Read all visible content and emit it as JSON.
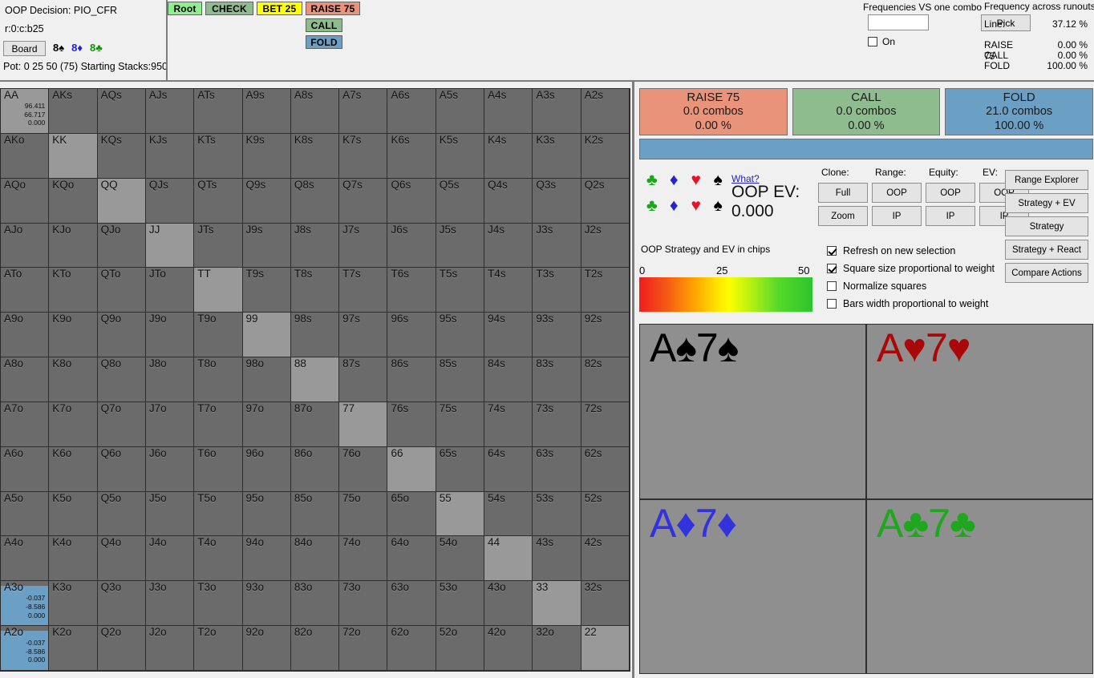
{
  "header": {
    "decision_label": "OOP Decision:  PIO_CFR",
    "line_path": "r:0:c:b25",
    "board_button": "Board",
    "board_cards": [
      {
        "rank": "8",
        "suit": "♠",
        "suit_name": "spade"
      },
      {
        "rank": "8",
        "suit": "♦",
        "suit_name": "diamond"
      },
      {
        "rank": "8",
        "suit": "♣",
        "suit_name": "club"
      }
    ],
    "pot_line": "Pot: 0 25 50 (75) Starting Stacks:950"
  },
  "tree": {
    "nodes": [
      {
        "label": "Root",
        "key": "root",
        "color": "#90ee90"
      },
      {
        "label": "CHECK",
        "key": "check",
        "color": "#8fbc8f"
      },
      {
        "label": "BET 25",
        "key": "bet25",
        "color": "#ffff00"
      },
      {
        "label": "RAISE 75",
        "key": "raise",
        "color": "#e8937a"
      },
      {
        "label": "CALL",
        "key": "call",
        "color": "#8fbc8f"
      },
      {
        "label": "FOLD",
        "key": "fold",
        "color": "#6b9fc4"
      }
    ]
  },
  "frequencies": {
    "vs_one_combo_label": "Frequencies VS one combo",
    "input_value": "",
    "pick_button": "Pick",
    "on_label": "On",
    "on_checked": false,
    "runouts_title": "Frequency across runouts:",
    "line_label": "Line:",
    "line_value": "37.12 %",
    "rows": [
      {
        "name": "RAISE 75",
        "value": "0.00 %"
      },
      {
        "name": "CALL",
        "value": "0.00 %"
      },
      {
        "name": "FOLD",
        "value": "100.00 %"
      }
    ]
  },
  "actions": [
    {
      "name": "RAISE 75",
      "combos": "0.0 combos",
      "pct": "0.00 %",
      "color": "#e8937a",
      "width_pct": 0
    },
    {
      "name": "CALL",
      "combos": "0.0 combos",
      "pct": "0.00 %",
      "color": "#8fbc8f",
      "width_pct": 0
    },
    {
      "name": "FOLD",
      "combos": "21.0 combos",
      "pct": "100.00 %",
      "color": "#6b9fc4",
      "width_pct": 100
    }
  ],
  "suits": {
    "rows": [
      [
        "club",
        "diamond",
        "heart",
        "spade"
      ],
      [
        "club",
        "diamond",
        "heart",
        "spade"
      ]
    ],
    "glyphs": {
      "club": "♣",
      "diamond": "♦",
      "heart": "♥",
      "spade": "♠"
    }
  },
  "ev": {
    "what_link": "What?",
    "label": "OOP EV:",
    "value": "0.000"
  },
  "scale": {
    "caption": "OOP Strategy and EV in chips",
    "ticks": [
      "0",
      "25",
      "50"
    ]
  },
  "options": [
    {
      "label": "Refresh on new selection",
      "checked": true
    },
    {
      "label": "Square size proportional to weight",
      "checked": true
    },
    {
      "label": "Normalize squares",
      "checked": false
    },
    {
      "label": "Bars width proportional to weight",
      "checked": false
    }
  ],
  "mini_columns": [
    {
      "header": "Clone:",
      "buttons": [
        "Full",
        "Zoom"
      ]
    },
    {
      "header": "Range:",
      "buttons": [
        "OOP",
        "IP"
      ]
    },
    {
      "header": "Equity:",
      "buttons": [
        "OOP",
        "IP"
      ]
    },
    {
      "header": "EV:",
      "buttons": [
        "OOP",
        "IP"
      ]
    }
  ],
  "side_buttons": [
    "Range Explorer",
    "Strategy + EV",
    "Strategy",
    "Strategy + React",
    "Compare Actions"
  ],
  "quadrants": [
    {
      "text": "A♠7♠",
      "suit": "spade"
    },
    {
      "text": "A♥7♥",
      "suit": "heart"
    },
    {
      "text": "A♦7♦",
      "suit": "diam"
    },
    {
      "text": "A♣7♣",
      "suit": "club"
    }
  ],
  "matrix": {
    "selected_fill_color": "#6b9fc4",
    "rows": [
      [
        {
          "l": "AA",
          "pair": true,
          "nums": [
            "96.411",
            "66.717",
            "0.000"
          ]
        },
        {
          "l": "AKs"
        },
        {
          "l": "AQs"
        },
        {
          "l": "AJs"
        },
        {
          "l": "ATs"
        },
        {
          "l": "A9s"
        },
        {
          "l": "A8s"
        },
        {
          "l": "A7s"
        },
        {
          "l": "A6s"
        },
        {
          "l": "A5s"
        },
        {
          "l": "A4s"
        },
        {
          "l": "A3s"
        },
        {
          "l": "A2s"
        }
      ],
      [
        {
          "l": "AKo"
        },
        {
          "l": "KK",
          "pair": true
        },
        {
          "l": "KQs"
        },
        {
          "l": "KJs"
        },
        {
          "l": "KTs"
        },
        {
          "l": "K9s"
        },
        {
          "l": "K8s"
        },
        {
          "l": "K7s"
        },
        {
          "l": "K6s"
        },
        {
          "l": "K5s"
        },
        {
          "l": "K4s"
        },
        {
          "l": "K3s"
        },
        {
          "l": "K2s"
        }
      ],
      [
        {
          "l": "AQo"
        },
        {
          "l": "KQo"
        },
        {
          "l": "QQ",
          "pair": true
        },
        {
          "l": "QJs"
        },
        {
          "l": "QTs"
        },
        {
          "l": "Q9s"
        },
        {
          "l": "Q8s"
        },
        {
          "l": "Q7s"
        },
        {
          "l": "Q6s"
        },
        {
          "l": "Q5s"
        },
        {
          "l": "Q4s"
        },
        {
          "l": "Q3s"
        },
        {
          "l": "Q2s"
        }
      ],
      [
        {
          "l": "AJo"
        },
        {
          "l": "KJo"
        },
        {
          "l": "QJo"
        },
        {
          "l": "JJ",
          "pair": true
        },
        {
          "l": "JTs"
        },
        {
          "l": "J9s"
        },
        {
          "l": "J8s"
        },
        {
          "l": "J7s"
        },
        {
          "l": "J6s"
        },
        {
          "l": "J5s"
        },
        {
          "l": "J4s"
        },
        {
          "l": "J3s"
        },
        {
          "l": "J2s"
        }
      ],
      [
        {
          "l": "ATo"
        },
        {
          "l": "KTo"
        },
        {
          "l": "QTo"
        },
        {
          "l": "JTo"
        },
        {
          "l": "TT",
          "pair": true
        },
        {
          "l": "T9s"
        },
        {
          "l": "T8s"
        },
        {
          "l": "T7s"
        },
        {
          "l": "T6s"
        },
        {
          "l": "T5s"
        },
        {
          "l": "T4s"
        },
        {
          "l": "T3s"
        },
        {
          "l": "T2s"
        }
      ],
      [
        {
          "l": "A9o"
        },
        {
          "l": "K9o"
        },
        {
          "l": "Q9o"
        },
        {
          "l": "J9o"
        },
        {
          "l": "T9o"
        },
        {
          "l": "99",
          "pair": true
        },
        {
          "l": "98s"
        },
        {
          "l": "97s"
        },
        {
          "l": "96s"
        },
        {
          "l": "95s"
        },
        {
          "l": "94s"
        },
        {
          "l": "93s"
        },
        {
          "l": "92s"
        }
      ],
      [
        {
          "l": "A8o"
        },
        {
          "l": "K8o"
        },
        {
          "l": "Q8o"
        },
        {
          "l": "J8o"
        },
        {
          "l": "T8o"
        },
        {
          "l": "98o"
        },
        {
          "l": "88",
          "pair": true
        },
        {
          "l": "87s"
        },
        {
          "l": "86s"
        },
        {
          "l": "85s"
        },
        {
          "l": "84s"
        },
        {
          "l": "83s"
        },
        {
          "l": "82s"
        }
      ],
      [
        {
          "l": "A7o"
        },
        {
          "l": "K7o"
        },
        {
          "l": "Q7o"
        },
        {
          "l": "J7o"
        },
        {
          "l": "T7o"
        },
        {
          "l": "97o"
        },
        {
          "l": "87o"
        },
        {
          "l": "77",
          "pair": true
        },
        {
          "l": "76s"
        },
        {
          "l": "75s"
        },
        {
          "l": "74s"
        },
        {
          "l": "73s"
        },
        {
          "l": "72s"
        }
      ],
      [
        {
          "l": "A6o"
        },
        {
          "l": "K6o"
        },
        {
          "l": "Q6o"
        },
        {
          "l": "J6o"
        },
        {
          "l": "T6o"
        },
        {
          "l": "96o"
        },
        {
          "l": "86o"
        },
        {
          "l": "76o"
        },
        {
          "l": "66",
          "pair": true
        },
        {
          "l": "65s"
        },
        {
          "l": "64s"
        },
        {
          "l": "63s"
        },
        {
          "l": "62s"
        }
      ],
      [
        {
          "l": "A5o"
        },
        {
          "l": "K5o"
        },
        {
          "l": "Q5o"
        },
        {
          "l": "J5o"
        },
        {
          "l": "T5o"
        },
        {
          "l": "95o"
        },
        {
          "l": "85o"
        },
        {
          "l": "75o"
        },
        {
          "l": "65o"
        },
        {
          "l": "55",
          "pair": true
        },
        {
          "l": "54s"
        },
        {
          "l": "53s"
        },
        {
          "l": "52s"
        }
      ],
      [
        {
          "l": "A4o"
        },
        {
          "l": "K4o"
        },
        {
          "l": "Q4o"
        },
        {
          "l": "J4o"
        },
        {
          "l": "T4o"
        },
        {
          "l": "94o"
        },
        {
          "l": "84o"
        },
        {
          "l": "74o"
        },
        {
          "l": "64o"
        },
        {
          "l": "54o"
        },
        {
          "l": "44",
          "pair": true
        },
        {
          "l": "43s"
        },
        {
          "l": "42s"
        }
      ],
      [
        {
          "l": "A3o",
          "selected": true,
          "nums": [
            "-0.037",
            "-8.586",
            "0.000"
          ]
        },
        {
          "l": "K3o"
        },
        {
          "l": "Q3o"
        },
        {
          "l": "J3o"
        },
        {
          "l": "T3o"
        },
        {
          "l": "93o"
        },
        {
          "l": "83o"
        },
        {
          "l": "73o"
        },
        {
          "l": "63o"
        },
        {
          "l": "53o"
        },
        {
          "l": "43o"
        },
        {
          "l": "33",
          "pair": true
        },
        {
          "l": "32s"
        }
      ],
      [
        {
          "l": "A2o",
          "selected": true,
          "nums": [
            "-0.037",
            "-8.586",
            "0.000"
          ]
        },
        {
          "l": "K2o"
        },
        {
          "l": "Q2o"
        },
        {
          "l": "J2o"
        },
        {
          "l": "T2o"
        },
        {
          "l": "92o"
        },
        {
          "l": "82o"
        },
        {
          "l": "72o"
        },
        {
          "l": "62o"
        },
        {
          "l": "52o"
        },
        {
          "l": "42o"
        },
        {
          "l": "32o"
        },
        {
          "l": "22",
          "pair": true
        }
      ]
    ]
  }
}
